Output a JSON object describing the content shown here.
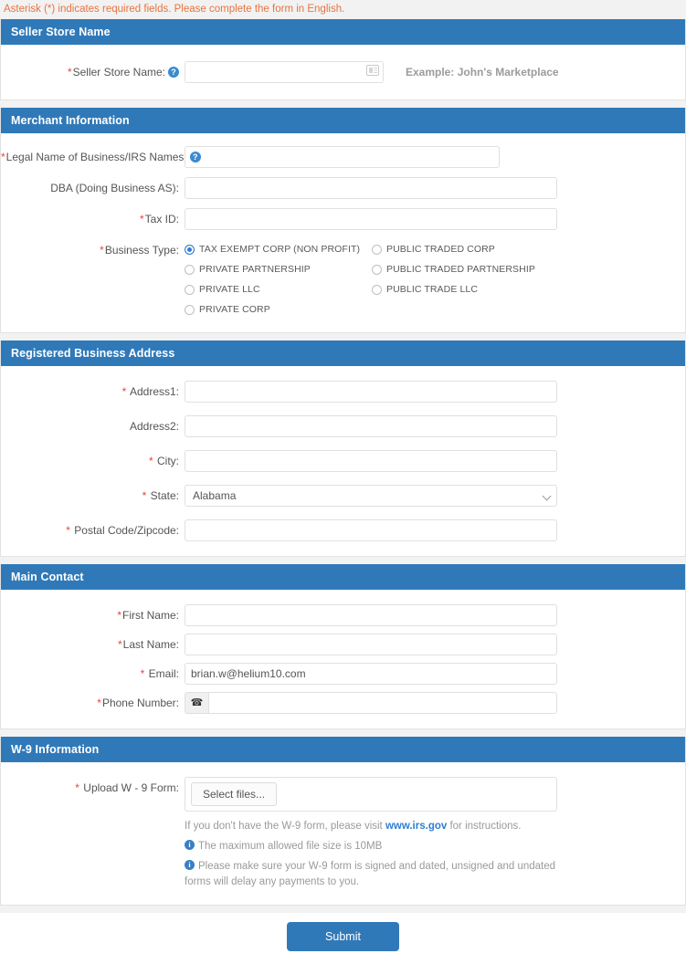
{
  "notice": "Asterisk (*) indicates required fields. Please complete the form in English.",
  "colors": {
    "header_blue": "#3079b8",
    "notice_orange": "#e8733f",
    "required_red": "#e8423f",
    "link_blue": "#2d7dd2",
    "radio_selected": "#2d7dd2"
  },
  "sections": {
    "seller_store_name": {
      "header": "Seller Store Name",
      "field_label": "Seller Store Name:",
      "help_icon": "question-mark-circle-icon",
      "input_value": "",
      "input_placeholder": "",
      "input_icon": "contact-card-icon",
      "example_text": "Example: John's Marketplace"
    },
    "merchant_information": {
      "header": "Merchant Information",
      "legal_name_label": "Legal Name of Business/IRS Names:",
      "legal_name_help_icon": "question-mark-circle-icon",
      "legal_name_value": "",
      "dba_label": "DBA (Doing Business AS):",
      "dba_value": "",
      "tax_id_label": "Tax ID:",
      "tax_id_value": "",
      "business_type_label": "Business Type:",
      "business_type_options": [
        {
          "label": "TAX EXEMPT CORP (NON PROFIT)",
          "selected": true
        },
        {
          "label": "PUBLIC TRADED CORP",
          "selected": false
        },
        {
          "label": "PRIVATE PARTNERSHIP",
          "selected": false
        },
        {
          "label": "PUBLIC TRADED PARTNERSHIP",
          "selected": false
        },
        {
          "label": "PRIVATE LLC",
          "selected": false
        },
        {
          "label": "PUBLIC TRADE LLC",
          "selected": false
        },
        {
          "label": "PRIVATE CORP",
          "selected": false
        }
      ]
    },
    "registered_business_address": {
      "header": "Registered Business Address",
      "address1_label": "Address1:",
      "address1_value": "",
      "address2_label": "Address2:",
      "address2_value": "",
      "city_label": "City:",
      "city_value": "",
      "state_label": "State:",
      "state_value": "Alabama",
      "state_chevron_icon": "chevron-down-icon",
      "postal_label": "Postal Code/Zipcode:",
      "postal_value": ""
    },
    "main_contact": {
      "header": "Main Contact",
      "first_name_label": "First Name:",
      "first_name_value": "",
      "last_name_label": "Last Name:",
      "last_name_value": "",
      "email_label": "Email:",
      "email_value": "brian.w@helium10.com",
      "phone_label": "Phone Number:",
      "phone_value": "",
      "phone_icon": "phone-icon"
    },
    "w9_information": {
      "header": "W-9 Information",
      "upload_label": "Upload W - 9 Form:",
      "select_files_button": "Select files...",
      "hint_prefix": "If you don't have the W-9 form, please visit ",
      "hint_link": "www.irs.gov",
      "hint_suffix": " for instructions.",
      "info_icon": "info-circle-icon",
      "max_size_text": "The maximum allowed file size is 10MB",
      "signed_text": "Please make sure your W-9 form is signed and dated, unsigned and undated forms will delay any payments to you."
    }
  },
  "submit": {
    "label": "Submit"
  }
}
